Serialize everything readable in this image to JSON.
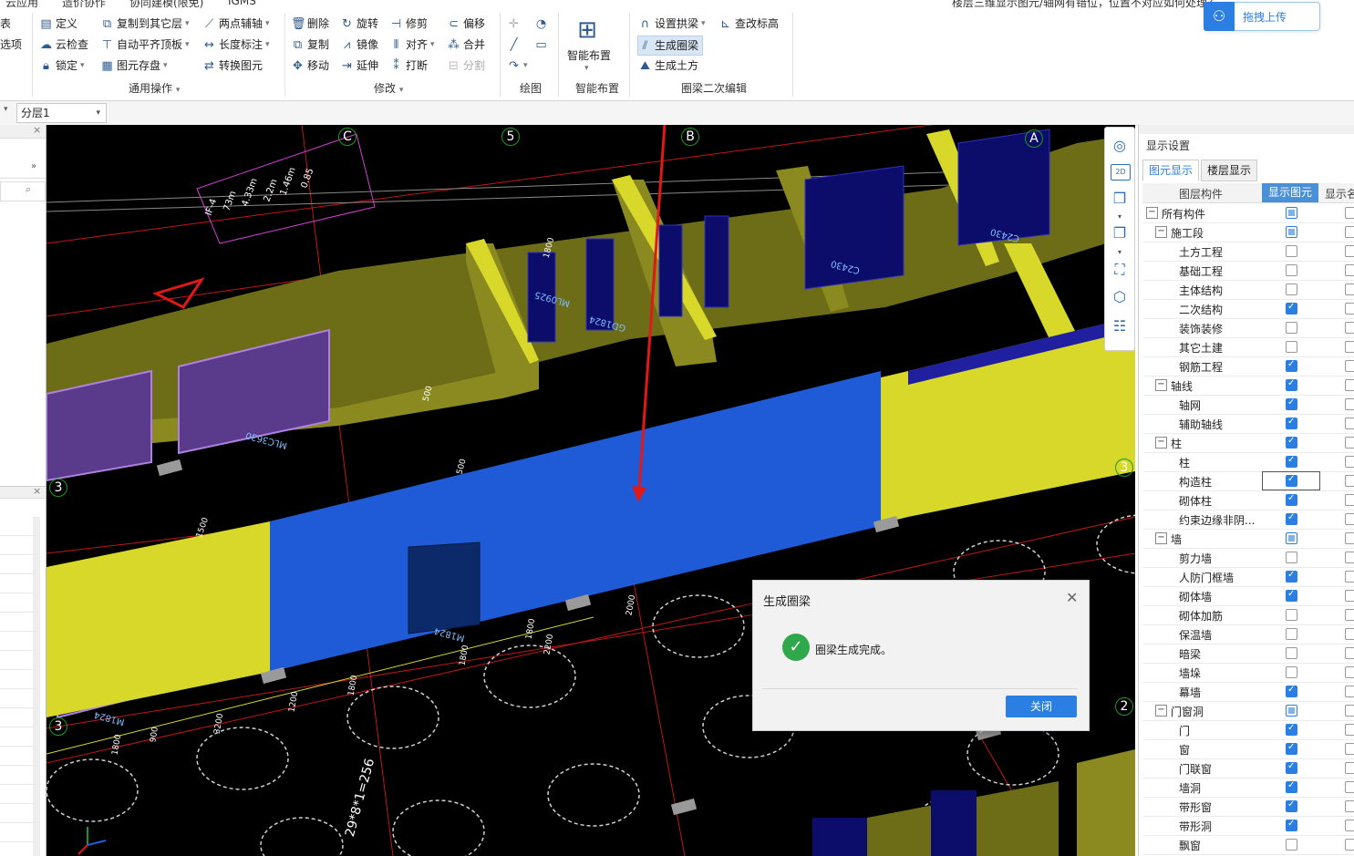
{
  "top_tabs": [
    "云应用",
    "造价协作",
    "协同建模(限免)",
    "IGMS"
  ],
  "top_notice": "楼层三维显示图元/轴网有错位，位置不对应如何处理？",
  "upload_label": "拖拽上传",
  "ribbon": {
    "left_cut": [
      "表",
      "选项"
    ],
    "general": {
      "items": [
        "定义",
        "复制到其它层",
        "两点辅轴",
        "云检查",
        "自动平齐顶板",
        "长度标注",
        "锁定",
        "图元存盘",
        "转换图元"
      ],
      "label": "通用操作"
    },
    "modify": {
      "items": [
        "删除",
        "旋转",
        "修剪",
        "偏移",
        "复制",
        "镜像",
        "对齐",
        "合并",
        "移动",
        "延伸",
        "打断",
        "分割"
      ],
      "label": "修改"
    },
    "draw": {
      "label": "绘图"
    },
    "smart": {
      "button": "智能布置",
      "label": "智能布置"
    },
    "ringbeam": {
      "items": [
        "设置拱梁",
        "查改标高",
        "生成圈梁",
        "生成土方"
      ],
      "label": "圈梁二次编辑"
    }
  },
  "layer_select": "分层1",
  "viewport": {
    "axis_labels": [
      "C",
      "5",
      "B",
      "A",
      "3",
      "3",
      "3",
      "2"
    ],
    "dims": [
      "500",
      "500",
      "1800",
      "2200",
      "3200",
      "1800",
      "1800",
      "1800",
      "2000",
      "900",
      "1200",
      "1500",
      "1800"
    ],
    "codes": [
      "MLC3630",
      "C2430",
      "C2430",
      "M1824",
      "M1824",
      "ML0925",
      "GD1824"
    ],
    "seat_label": "29*8*1=256"
  },
  "display_panel": {
    "title": "显示设置",
    "tabs": [
      "图元显示",
      "楼层显示"
    ],
    "headers": [
      "图层构件",
      "显示图元",
      "显示名"
    ],
    "rows": [
      {
        "label": "所有构件",
        "level": 0,
        "expand": "−",
        "state": "part"
      },
      {
        "label": "施工段",
        "level": 1,
        "expand": "−",
        "state": "part"
      },
      {
        "label": "土方工程",
        "level": 2,
        "state": "off"
      },
      {
        "label": "基础工程",
        "level": 2,
        "state": "off"
      },
      {
        "label": "主体结构",
        "level": 2,
        "state": "off"
      },
      {
        "label": "二次结构",
        "level": 2,
        "state": "on"
      },
      {
        "label": "装饰装修",
        "level": 2,
        "state": "off"
      },
      {
        "label": "其它土建",
        "level": 2,
        "state": "off"
      },
      {
        "label": "钢筋工程",
        "level": 2,
        "state": "on"
      },
      {
        "label": "轴线",
        "level": 1,
        "expand": "−",
        "state": "on"
      },
      {
        "label": "轴网",
        "level": 2,
        "state": "on"
      },
      {
        "label": "辅助轴线",
        "level": 2,
        "state": "on"
      },
      {
        "label": "柱",
        "level": 1,
        "expand": "−",
        "state": "on"
      },
      {
        "label": "柱",
        "level": 2,
        "state": "on"
      },
      {
        "label": "构造柱",
        "level": 2,
        "state": "on",
        "focus": true
      },
      {
        "label": "砌体柱",
        "level": 2,
        "state": "on"
      },
      {
        "label": "约束边缘非阴...",
        "level": 2,
        "state": "on"
      },
      {
        "label": "墙",
        "level": 1,
        "expand": "−",
        "state": "part"
      },
      {
        "label": "剪力墙",
        "level": 2,
        "state": "off"
      },
      {
        "label": "人防门框墙",
        "level": 2,
        "state": "on"
      },
      {
        "label": "砌体墙",
        "level": 2,
        "state": "on"
      },
      {
        "label": "砌体加筋",
        "level": 2,
        "state": "off"
      },
      {
        "label": "保温墙",
        "level": 2,
        "state": "off"
      },
      {
        "label": "暗梁",
        "level": 2,
        "state": "off"
      },
      {
        "label": "墙垛",
        "level": 2,
        "state": "off"
      },
      {
        "label": "幕墙",
        "level": 2,
        "state": "on"
      },
      {
        "label": "门窗洞",
        "level": 1,
        "expand": "−",
        "state": "part"
      },
      {
        "label": "门",
        "level": 2,
        "state": "on"
      },
      {
        "label": "窗",
        "level": 2,
        "state": "on"
      },
      {
        "label": "门联窗",
        "level": 2,
        "state": "on"
      },
      {
        "label": "墙洞",
        "level": 2,
        "state": "on"
      },
      {
        "label": "带形窗",
        "level": 2,
        "state": "on"
      },
      {
        "label": "带形洞",
        "level": 2,
        "state": "on"
      },
      {
        "label": "飘窗",
        "level": 2,
        "state": "off"
      }
    ]
  },
  "dialog": {
    "title": "生成圈梁",
    "message": "圈梁生成完成。",
    "button": "关闭"
  },
  "colors": {
    "accent": "#2b7fe3",
    "wall_yellow": "#d8d82a",
    "wall_olive": "#8a8a20",
    "beam_blue": "#1f5bd6",
    "arrow_red": "#e01818"
  }
}
